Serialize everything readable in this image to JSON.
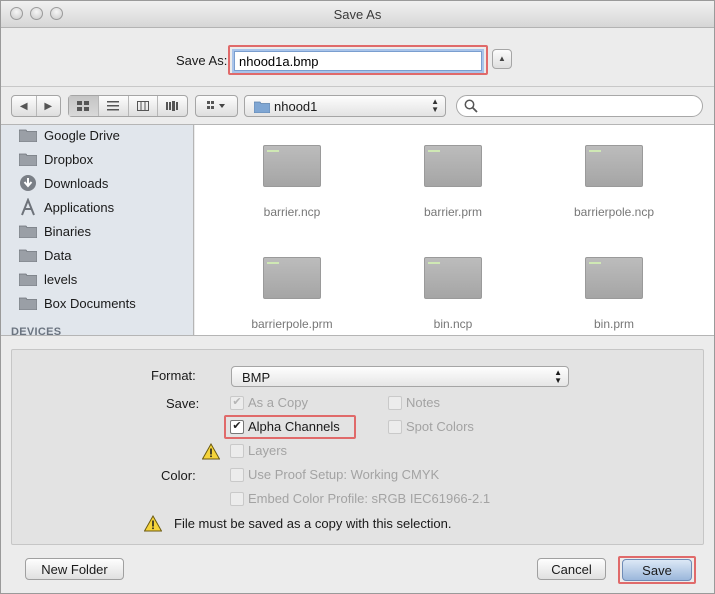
{
  "window": {
    "title": "Save As"
  },
  "saveas": {
    "label": "Save As:",
    "filename": "nhood1a.bmp"
  },
  "toolbar": {
    "path_folder": "nhood1"
  },
  "sidebar": {
    "items": [
      {
        "label": "Google Drive",
        "icon": "folder-icon"
      },
      {
        "label": "Dropbox",
        "icon": "folder-icon"
      },
      {
        "label": "Downloads",
        "icon": "downloads-icon"
      },
      {
        "label": "Applications",
        "icon": "applications-icon"
      },
      {
        "label": "Binaries",
        "icon": "folder-icon"
      },
      {
        "label": "Data",
        "icon": "folder-icon"
      },
      {
        "label": "levels",
        "icon": "folder-icon"
      },
      {
        "label": "Box Documents",
        "icon": "folder-icon"
      }
    ],
    "devices_heading": "DEVICES"
  },
  "files": [
    {
      "name": "barrier.ncp"
    },
    {
      "name": "barrier.prm"
    },
    {
      "name": "barrierpole.ncp"
    },
    {
      "name": "barrierpole.prm"
    },
    {
      "name": "bin.ncp"
    },
    {
      "name": "bin.prm"
    }
  ],
  "options": {
    "format_label": "Format:",
    "format_value": "BMP",
    "save_label": "Save:",
    "as_copy": "As a Copy",
    "notes": "Notes",
    "alpha_channels": "Alpha Channels",
    "spot_colors": "Spot Colors",
    "layers": "Layers",
    "color_label": "Color:",
    "use_proof": "Use Proof Setup:  Working CMYK",
    "embed_profile": "Embed Color Profile:  sRGB IEC61966-2.1",
    "warning": "File must be saved as a copy with this selection."
  },
  "buttons": {
    "new_folder": "New Folder",
    "cancel": "Cancel",
    "save": "Save"
  }
}
